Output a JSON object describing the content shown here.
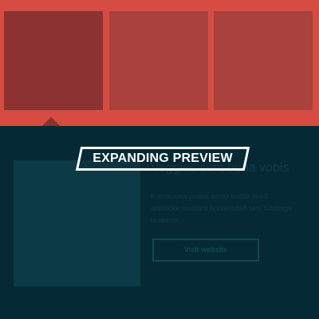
{
  "grid": {
    "thumbnails": [
      {
        "label": "",
        "state": "active"
      },
      {
        "label": "",
        "state": "inactive"
      },
      {
        "label": "",
        "state": "inactive"
      }
    ],
    "colors": {
      "strip": "#d64c42",
      "thumb_inactive": "#a9413c",
      "thumb_active": "#8c3232"
    }
  },
  "panel": {
    "title": "Veggies sunt bona vobis",
    "body": "Komatsuna prairie turnip wattle seed artichoke mustard horseradish taro rutabaga ricebean.",
    "button_label": "Visit website",
    "background": "#052a35"
  },
  "overlay": {
    "label": "EXPANDING PREVIEW"
  }
}
